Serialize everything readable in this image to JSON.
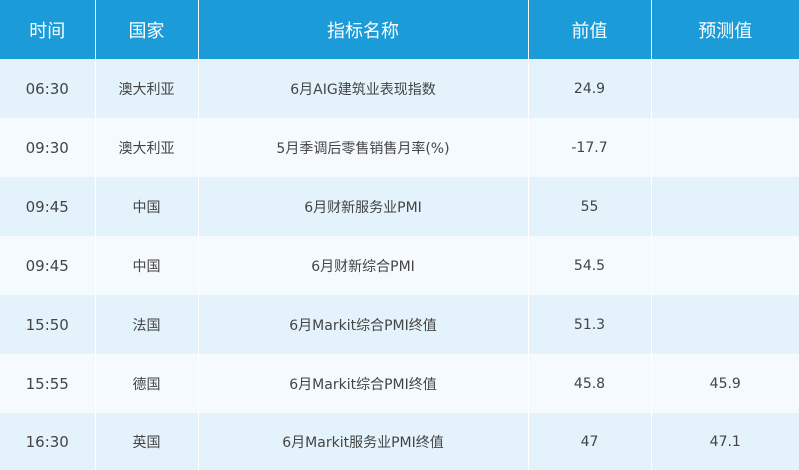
{
  "colors": {
    "header_bg": "#1b9bd8",
    "header_text": "#ffffff",
    "row_odd": "#e3f2fb",
    "row_even": "#f4fafe",
    "cell_text": "#444444"
  },
  "table": {
    "headers": {
      "time": "时间",
      "country": "国家",
      "indicator": "指标名称",
      "previous": "前值",
      "forecast": "预测值"
    },
    "rows": [
      {
        "time": "06:30",
        "country": "澳大利亚",
        "indicator": "6月AIG建筑业表现指数",
        "previous": "24.9",
        "forecast": ""
      },
      {
        "time": "09:30",
        "country": "澳大利亚",
        "indicator": "5月季调后零售销售月率(%)",
        "previous": "-17.7",
        "forecast": ""
      },
      {
        "time": "09:45",
        "country": "中国",
        "indicator": "6月财新服务业PMI",
        "previous": "55",
        "forecast": ""
      },
      {
        "time": "09:45",
        "country": "中国",
        "indicator": "6月财新综合PMI",
        "previous": "54.5",
        "forecast": ""
      },
      {
        "time": "15:50",
        "country": "法国",
        "indicator": "6月Markit综合PMI终值",
        "previous": "51.3",
        "forecast": ""
      },
      {
        "time": "15:55",
        "country": "德国",
        "indicator": "6月Markit综合PMI终值",
        "previous": "45.8",
        "forecast": "45.9"
      },
      {
        "time": "16:30",
        "country": "英国",
        "indicator": "6月Markit服务业PMI终值",
        "previous": "47",
        "forecast": "47.1"
      }
    ]
  }
}
